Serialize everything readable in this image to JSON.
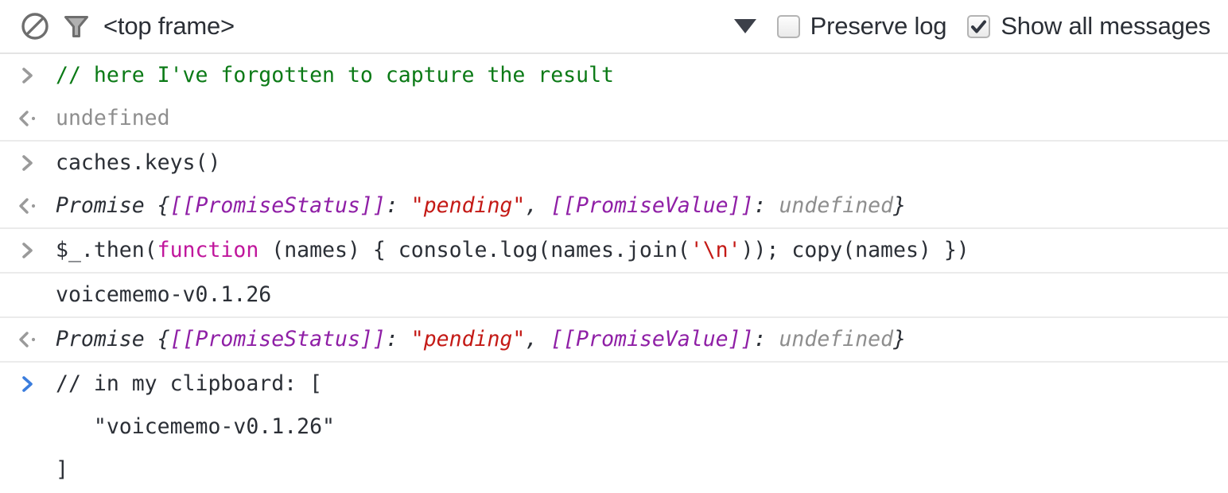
{
  "toolbar": {
    "clear_icon": "clear-console-icon",
    "filter_icon": "filter-funnel-icon",
    "frame_label": "<top frame>",
    "dropdown_icon": "chevron-down-icon",
    "preserve_log": {
      "label": "Preserve log",
      "checked": false
    },
    "show_all_messages": {
      "label": "Show all messages",
      "checked": true
    }
  },
  "colors": {
    "comment_green": "#0b7a16",
    "string_red": "#c41a16",
    "keyword_magenta": "#c0169c",
    "internal_purple": "#8f1fa6",
    "gray": "#8e8e8e",
    "text_dark": "#2b2f36",
    "prompt_blue": "#3b7ddd",
    "prompt_gray": "#9a9a9a",
    "rule": "#ebebeb"
  },
  "log": {
    "entries": [
      {
        "id": "entry-1",
        "rows": [
          {
            "gutter": "prompt-input-icon",
            "gutter_color": "gray",
            "tokens": [
              {
                "t": "// here I've forgotten to capture the result",
                "c": "tok-comment"
              }
            ]
          },
          {
            "gutter": "result-arrow-icon",
            "gutter_color": "gray",
            "tokens": [
              {
                "t": "undefined",
                "c": "tok-gray"
              }
            ]
          }
        ]
      },
      {
        "id": "entry-2",
        "rows": [
          {
            "gutter": "prompt-input-icon",
            "gutter_color": "gray",
            "tokens": [
              {
                "t": "caches.keys()",
                "c": "tok-plain"
              }
            ]
          },
          {
            "gutter": "result-arrow-icon",
            "gutter_color": "gray",
            "italic": true,
            "tokens": [
              {
                "t": "Promise {",
                "c": "tok-plain"
              },
              {
                "t": "[[PromiseStatus]]",
                "c": "tok-internal"
              },
              {
                "t": ": ",
                "c": "tok-plain"
              },
              {
                "t": "\"pending\"",
                "c": "tok-string"
              },
              {
                "t": ", ",
                "c": "tok-plain"
              },
              {
                "t": "[[PromiseValue]]",
                "c": "tok-internal"
              },
              {
                "t": ": ",
                "c": "tok-plain"
              },
              {
                "t": "undefined",
                "c": "tok-gray"
              },
              {
                "t": "}",
                "c": "tok-plain"
              }
            ]
          }
        ]
      },
      {
        "id": "entry-3",
        "rows": [
          {
            "gutter": "prompt-input-icon",
            "gutter_color": "gray",
            "tokens": [
              {
                "t": "$_.then(",
                "c": "tok-plain"
              },
              {
                "t": "function",
                "c": "tok-keyword"
              },
              {
                "t": " (names) { console.log(names.join(",
                "c": "tok-plain"
              },
              {
                "t": "'\\n'",
                "c": "tok-string"
              },
              {
                "t": ")); copy(names) })",
                "c": "tok-plain"
              }
            ]
          }
        ]
      },
      {
        "id": "entry-4",
        "rows": [
          {
            "gutter": "none",
            "gutter_color": "none",
            "tokens": [
              {
                "t": "voicememo-v0.1.26",
                "c": "tok-plain"
              }
            ]
          }
        ]
      },
      {
        "id": "entry-5",
        "rows": [
          {
            "gutter": "result-arrow-icon",
            "gutter_color": "gray",
            "italic": true,
            "tokens": [
              {
                "t": "Promise {",
                "c": "tok-plain"
              },
              {
                "t": "[[PromiseStatus]]",
                "c": "tok-internal"
              },
              {
                "t": ": ",
                "c": "tok-plain"
              },
              {
                "t": "\"pending\"",
                "c": "tok-string"
              },
              {
                "t": ", ",
                "c": "tok-plain"
              },
              {
                "t": "[[PromiseValue]]",
                "c": "tok-internal"
              },
              {
                "t": ": ",
                "c": "tok-plain"
              },
              {
                "t": "undefined",
                "c": "tok-gray"
              },
              {
                "t": "}",
                "c": "tok-plain"
              }
            ]
          }
        ]
      },
      {
        "id": "entry-6-active-input",
        "no_rule": true,
        "rows": [
          {
            "gutter": "prompt-input-icon",
            "gutter_color": "blue",
            "tokens": [
              {
                "t": "// in my clipboard: [\n   \"voicememo-v0.1.26\"\n]",
                "c": "tok-plain"
              }
            ]
          }
        ]
      }
    ]
  }
}
